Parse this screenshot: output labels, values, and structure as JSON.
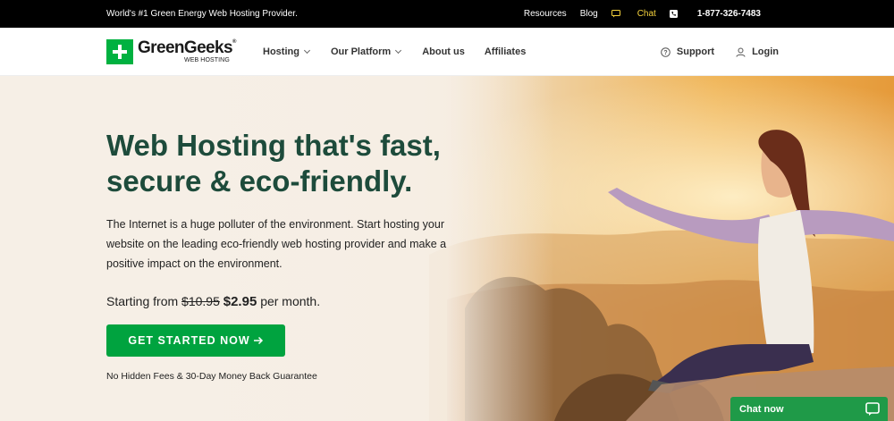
{
  "topbar": {
    "tagline": "World's #1 Green Energy Web Hosting Provider.",
    "links": {
      "resources": "Resources",
      "blog": "Blog",
      "chat": "Chat",
      "phone": "1-877-326-7483"
    }
  },
  "nav": {
    "logo": {
      "name": "GreenGeeks",
      "sub": "WEB HOSTING"
    },
    "menu": {
      "hosting": "Hosting",
      "platform": "Our Platform",
      "about": "About us",
      "affiliates": "Affiliates"
    },
    "support": "Support",
    "login": "Login"
  },
  "hero": {
    "headline": "Web Hosting that's fast, secure & eco-friendly.",
    "description": "The Internet is a huge polluter of the environment. Start hosting your website on the leading eco-friendly web hosting provider and make a positive impact on the environment.",
    "price_prefix": "Starting from",
    "price_old": "$10.95",
    "price_new": "$2.95",
    "price_suffix": "per month.",
    "cta_label": "GET STARTED NOW",
    "guarantee": "No Hidden Fees & 30-Day Money Back Guarantee"
  },
  "chat_widget": {
    "label": "Chat now"
  },
  "colors": {
    "brand_green": "#00b140",
    "cta_green": "#00a33f",
    "headline_green": "#1d4b3b",
    "topbar_bg": "#000000",
    "chat_highlight": "#f5d23d"
  }
}
